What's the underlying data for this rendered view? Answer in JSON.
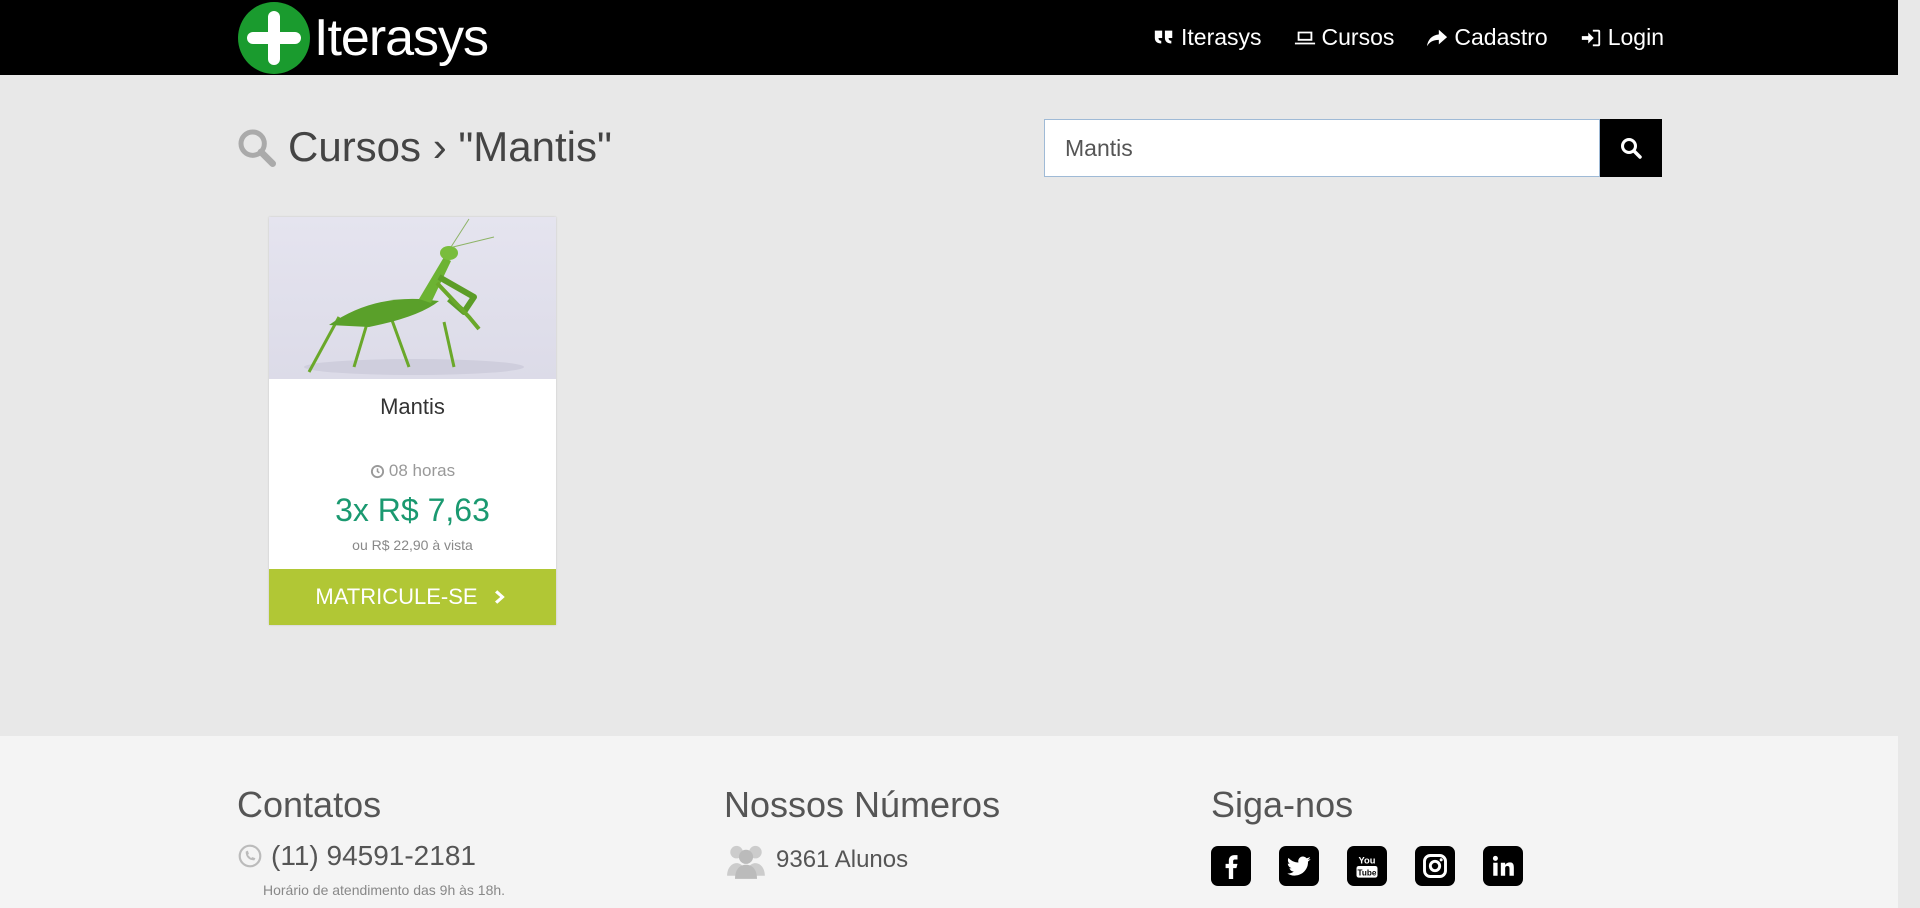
{
  "header": {
    "logo_text": "Iterasys",
    "brand_color": "#1a9b2e",
    "nav": [
      {
        "label": "Iterasys",
        "icon": "quote-icon"
      },
      {
        "label": "Cursos",
        "icon": "laptop-icon"
      },
      {
        "label": "Cadastro",
        "icon": "share-arrow-icon"
      },
      {
        "label": "Login",
        "icon": "sign-in-icon"
      }
    ]
  },
  "page": {
    "title": "Cursos › \"Mantis\""
  },
  "search": {
    "value": "Mantis",
    "icon": "search-icon"
  },
  "course": {
    "title": "Mantis",
    "duration": "08 horas",
    "price_installment": "3x R$ 7,63",
    "price_cash": "ou R$ 22,90 à vista",
    "button_label": "MATRICULE-SE",
    "price_color": "#1a9970",
    "button_color": "#b1c735"
  },
  "footer": {
    "contacts": {
      "heading": "Contatos",
      "phone": "(11) 94591-2181",
      "hours": "Horário de atendimento das 9h às 18h."
    },
    "numbers": {
      "heading": "Nossos Números",
      "students": "9361 Alunos"
    },
    "social": {
      "heading": "Siga-nos",
      "icons": [
        "facebook-icon",
        "twitter-icon",
        "youtube-icon",
        "instagram-icon",
        "linkedin-icon"
      ]
    }
  }
}
